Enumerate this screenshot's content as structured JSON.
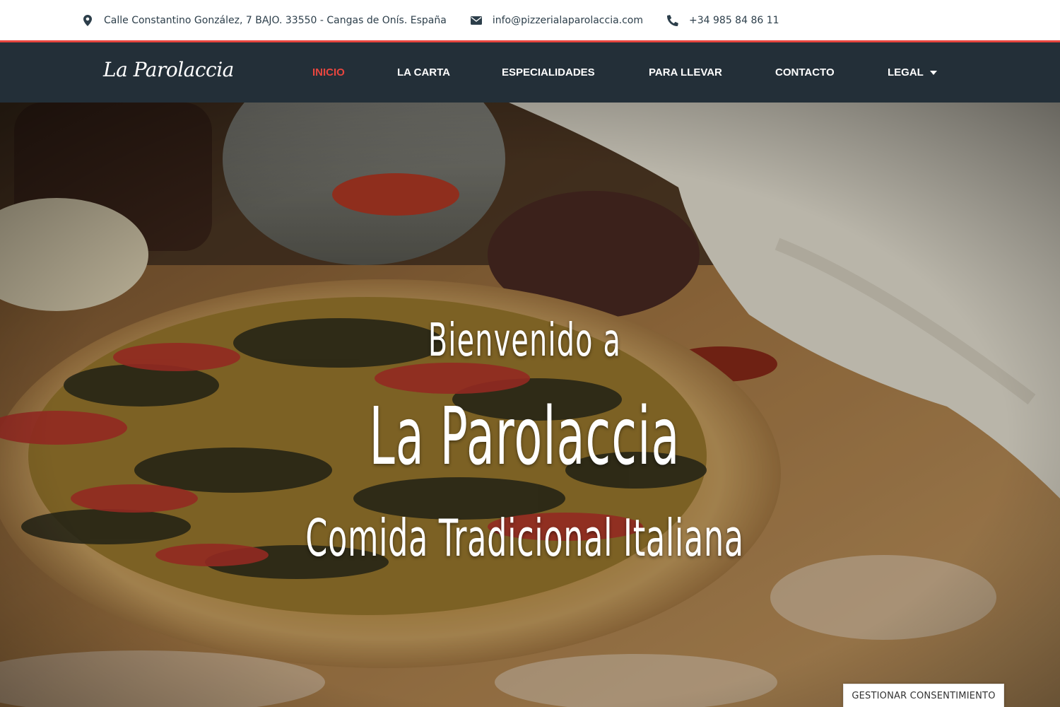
{
  "topbar": {
    "address": "Calle Constantino González, 7 BAJO. 33550 - Cangas de Onís. España",
    "email": "info@pizzerialaparolaccia.com",
    "phone": "+34 985 84 86 11"
  },
  "nav": {
    "logo": "La Parolaccia",
    "items": [
      {
        "label": "INICIO",
        "active": true
      },
      {
        "label": "LA CARTA"
      },
      {
        "label": "ESPECIALIDADES"
      },
      {
        "label": "PARA LLEVAR"
      },
      {
        "label": "CONTACTO"
      },
      {
        "label": "LEGAL"
      }
    ]
  },
  "hero": {
    "line1": "Bienvenido a",
    "line2": "La Parolaccia",
    "line3": "Comida Tradicional Italiana"
  },
  "consent": {
    "label": "GESTIONAR CONSENTIMIENTO"
  },
  "colors": {
    "accent": "#e8463f",
    "nav_bg": "#232f38",
    "text_dark": "#2c3e4a"
  }
}
